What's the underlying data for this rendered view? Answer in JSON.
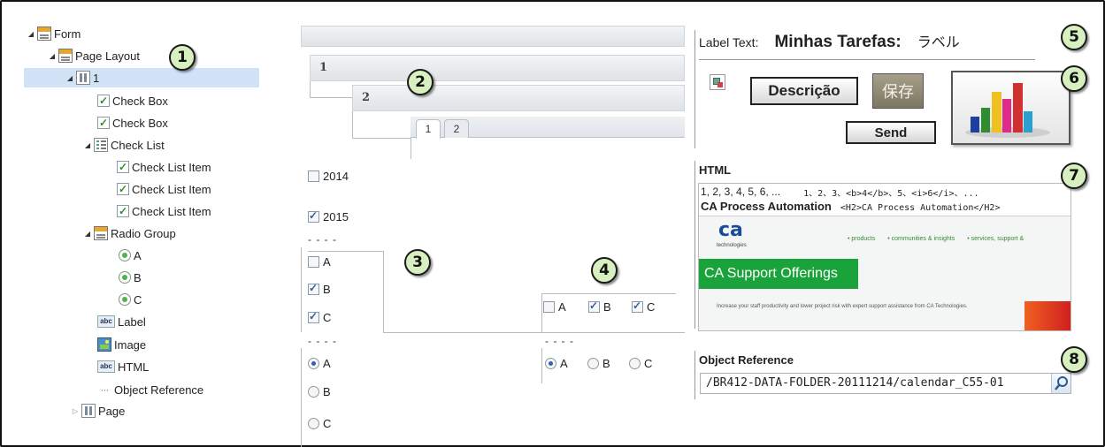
{
  "callouts": [
    "1",
    "2",
    "3",
    "4",
    "5",
    "6",
    "7",
    "8"
  ],
  "tree": {
    "form": "Form",
    "page_layout": "Page Layout",
    "node_1": "1",
    "check_box_1": "Check Box",
    "check_box_2": "Check Box",
    "check_list": "Check List",
    "check_list_item_1": "Check List Item",
    "check_list_item_2": "Check List Item",
    "check_list_item_3": "Check List Item",
    "radio_group": "Radio Group",
    "radio_a": "A",
    "radio_b": "B",
    "radio_c": "C",
    "label": "Label",
    "image": "Image",
    "html": "HTML",
    "object_reference": "Object Reference",
    "page": "Page",
    "abc_icon": "abc"
  },
  "layout": {
    "bar_1": "1",
    "bar_2": "2",
    "tabs": [
      "1",
      "2"
    ],
    "check_2014": "2014",
    "check_2015": "2015",
    "dashes": "- - - -",
    "vertical_checks": [
      "A",
      "B",
      "C"
    ],
    "horizontal_checks": [
      "A",
      "B",
      "C"
    ],
    "vertical_radios": [
      "A",
      "B",
      "C"
    ],
    "horizontal_radios": [
      "A",
      "B",
      "C"
    ]
  },
  "right": {
    "label_text_caption": "Label Text:",
    "label_bold": "Minhas Tarefas:",
    "label_japanese": "ラベル",
    "descricao_button": "Descrição",
    "save_button": "保存",
    "send_button": "Send",
    "html_header": "HTML",
    "html_line1_left": "1, 2, 3, 4, 5, 6, ...",
    "html_line1_right": "1、2、3、<b>4</b>、5、<i>6</i>、...",
    "html_line2_bold": "CA Process Automation",
    "html_line2_code": "<H2>CA Process Automation</H2>",
    "ca_logo": "ca",
    "ca_logo_sub": "technologies",
    "ca_nav": [
      "• products",
      "• communities & insights",
      "• services, support &"
    ],
    "ca_banner": "CA Support Offerings",
    "ca_body": "Increase your staff productivity and lower project risk with expert support assistance from CA Technologies.",
    "object_reference_header": "Object Reference",
    "object_reference_value": "/BR412-DATA-FOLDER-20111214/calendar_C55-01"
  },
  "colors": {
    "tree_selection": "#cfe2f6",
    "callout_fill": "#d8f0c0",
    "ca_green": "#1aa33a",
    "save_button_bg": "#8f8873"
  }
}
